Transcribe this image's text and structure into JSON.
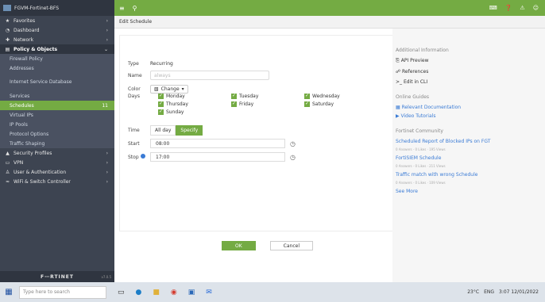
{
  "app": {
    "title": "FGVM-Fortinet-BFS",
    "footer_logo": "F⋯RTINET",
    "footer_version": "v7.0.5"
  },
  "sidebar": {
    "items": [
      {
        "label": "Favorites",
        "icon": "star-icon"
      },
      {
        "label": "Dashboard",
        "icon": "dashboard-icon"
      },
      {
        "label": "Network",
        "icon": "network-icon"
      },
      {
        "label": "Policy & Objects",
        "icon": "policy-icon"
      }
    ],
    "sub_items": [
      {
        "label": "Firewall Policy"
      },
      {
        "label": "Addresses"
      },
      {
        "label": "Internet Service Database"
      },
      {
        "label": "Services"
      },
      {
        "label": "Schedules",
        "count": "11"
      },
      {
        "label": "Virtual IPs"
      },
      {
        "label": "IP Pools"
      },
      {
        "label": "Protocol Options"
      },
      {
        "label": "Traffic Shaping"
      }
    ],
    "bottom_items": [
      {
        "label": "Security Profiles",
        "icon": "shield-icon"
      },
      {
        "label": "VPN",
        "icon": "vpn-icon"
      },
      {
        "label": "User & Authentication",
        "icon": "user-icon"
      },
      {
        "label": "WiFi & Switch Controller",
        "icon": "wifi-icon"
      }
    ]
  },
  "breadcrumb": "Edit Schedule",
  "form": {
    "type_label": "Type",
    "type_value": "Recurring",
    "name_label": "Name",
    "name_placeholder": "always",
    "color_label": "Color",
    "color_value": "Change",
    "days_label": "Days",
    "days": [
      "Monday",
      "Tuesday",
      "Wednesday",
      "Thursday",
      "Friday",
      "Saturday",
      "Sunday"
    ],
    "time_label": "Time",
    "time_all_day": "All day",
    "time_specify": "Specify",
    "start_label": "Start",
    "start_value": "08:00",
    "stop_label": "Stop",
    "stop_value": "17:00",
    "ok_label": "OK",
    "cancel_label": "Cancel"
  },
  "right_pane": {
    "title": "Additional Information",
    "items": [
      "API Preview",
      "References",
      "Edit in CLI"
    ],
    "guides_title": "Online Guides",
    "guides": [
      "Relevant Documentation",
      "Video Tutorials"
    ],
    "community_title": "Fortinet Community",
    "links": [
      {
        "text": "Scheduled Report of Blocked IPs on FGT",
        "meta": "0 Answers · 0 Likes · 195 Views"
      },
      {
        "text": "FortiSIEM Schedule",
        "meta": "0 Answers · 0 Likes · 211 Views"
      },
      {
        "text": "Traffic match with wrong Schedule",
        "meta": "0 Answers · 0 Likes · 109 Views"
      }
    ],
    "see_more": "See More"
  },
  "taskbar": {
    "search_placeholder": "Type here to search",
    "weather": "23°C",
    "lang": "ENG",
    "time": "3:07",
    "date": "12/01/2022"
  },
  "colors": {
    "accent": "#74ab43",
    "sidebar": "#3d4451",
    "link": "#3a7bd5"
  }
}
